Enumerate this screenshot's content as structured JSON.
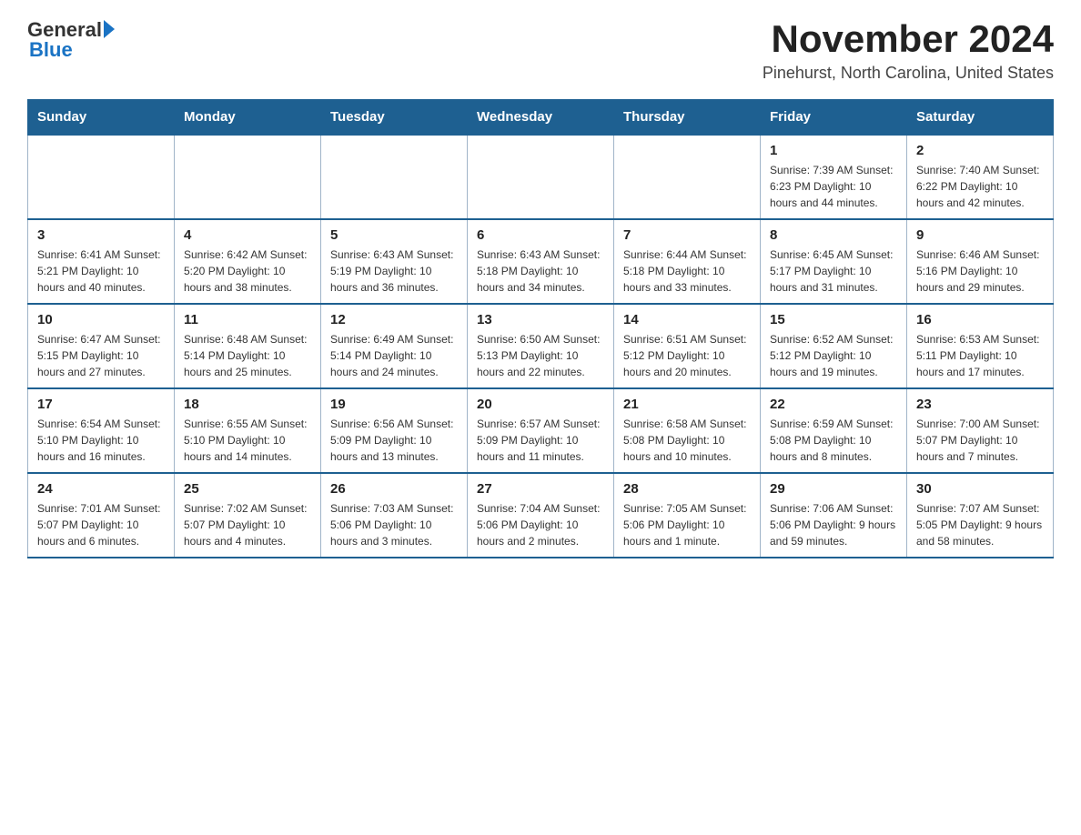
{
  "header": {
    "logo_general": "General",
    "logo_blue": "Blue",
    "title": "November 2024",
    "subtitle": "Pinehurst, North Carolina, United States"
  },
  "days_of_week": [
    "Sunday",
    "Monday",
    "Tuesday",
    "Wednesday",
    "Thursday",
    "Friday",
    "Saturday"
  ],
  "weeks": [
    {
      "days": [
        {
          "number": "",
          "info": ""
        },
        {
          "number": "",
          "info": ""
        },
        {
          "number": "",
          "info": ""
        },
        {
          "number": "",
          "info": ""
        },
        {
          "number": "",
          "info": ""
        },
        {
          "number": "1",
          "info": "Sunrise: 7:39 AM\nSunset: 6:23 PM\nDaylight: 10 hours and 44 minutes."
        },
        {
          "number": "2",
          "info": "Sunrise: 7:40 AM\nSunset: 6:22 PM\nDaylight: 10 hours and 42 minutes."
        }
      ]
    },
    {
      "days": [
        {
          "number": "3",
          "info": "Sunrise: 6:41 AM\nSunset: 5:21 PM\nDaylight: 10 hours and 40 minutes."
        },
        {
          "number": "4",
          "info": "Sunrise: 6:42 AM\nSunset: 5:20 PM\nDaylight: 10 hours and 38 minutes."
        },
        {
          "number": "5",
          "info": "Sunrise: 6:43 AM\nSunset: 5:19 PM\nDaylight: 10 hours and 36 minutes."
        },
        {
          "number": "6",
          "info": "Sunrise: 6:43 AM\nSunset: 5:18 PM\nDaylight: 10 hours and 34 minutes."
        },
        {
          "number": "7",
          "info": "Sunrise: 6:44 AM\nSunset: 5:18 PM\nDaylight: 10 hours and 33 minutes."
        },
        {
          "number": "8",
          "info": "Sunrise: 6:45 AM\nSunset: 5:17 PM\nDaylight: 10 hours and 31 minutes."
        },
        {
          "number": "9",
          "info": "Sunrise: 6:46 AM\nSunset: 5:16 PM\nDaylight: 10 hours and 29 minutes."
        }
      ]
    },
    {
      "days": [
        {
          "number": "10",
          "info": "Sunrise: 6:47 AM\nSunset: 5:15 PM\nDaylight: 10 hours and 27 minutes."
        },
        {
          "number": "11",
          "info": "Sunrise: 6:48 AM\nSunset: 5:14 PM\nDaylight: 10 hours and 25 minutes."
        },
        {
          "number": "12",
          "info": "Sunrise: 6:49 AM\nSunset: 5:14 PM\nDaylight: 10 hours and 24 minutes."
        },
        {
          "number": "13",
          "info": "Sunrise: 6:50 AM\nSunset: 5:13 PM\nDaylight: 10 hours and 22 minutes."
        },
        {
          "number": "14",
          "info": "Sunrise: 6:51 AM\nSunset: 5:12 PM\nDaylight: 10 hours and 20 minutes."
        },
        {
          "number": "15",
          "info": "Sunrise: 6:52 AM\nSunset: 5:12 PM\nDaylight: 10 hours and 19 minutes."
        },
        {
          "number": "16",
          "info": "Sunrise: 6:53 AM\nSunset: 5:11 PM\nDaylight: 10 hours and 17 minutes."
        }
      ]
    },
    {
      "days": [
        {
          "number": "17",
          "info": "Sunrise: 6:54 AM\nSunset: 5:10 PM\nDaylight: 10 hours and 16 minutes."
        },
        {
          "number": "18",
          "info": "Sunrise: 6:55 AM\nSunset: 5:10 PM\nDaylight: 10 hours and 14 minutes."
        },
        {
          "number": "19",
          "info": "Sunrise: 6:56 AM\nSunset: 5:09 PM\nDaylight: 10 hours and 13 minutes."
        },
        {
          "number": "20",
          "info": "Sunrise: 6:57 AM\nSunset: 5:09 PM\nDaylight: 10 hours and 11 minutes."
        },
        {
          "number": "21",
          "info": "Sunrise: 6:58 AM\nSunset: 5:08 PM\nDaylight: 10 hours and 10 minutes."
        },
        {
          "number": "22",
          "info": "Sunrise: 6:59 AM\nSunset: 5:08 PM\nDaylight: 10 hours and 8 minutes."
        },
        {
          "number": "23",
          "info": "Sunrise: 7:00 AM\nSunset: 5:07 PM\nDaylight: 10 hours and 7 minutes."
        }
      ]
    },
    {
      "days": [
        {
          "number": "24",
          "info": "Sunrise: 7:01 AM\nSunset: 5:07 PM\nDaylight: 10 hours and 6 minutes."
        },
        {
          "number": "25",
          "info": "Sunrise: 7:02 AM\nSunset: 5:07 PM\nDaylight: 10 hours and 4 minutes."
        },
        {
          "number": "26",
          "info": "Sunrise: 7:03 AM\nSunset: 5:06 PM\nDaylight: 10 hours and 3 minutes."
        },
        {
          "number": "27",
          "info": "Sunrise: 7:04 AM\nSunset: 5:06 PM\nDaylight: 10 hours and 2 minutes."
        },
        {
          "number": "28",
          "info": "Sunrise: 7:05 AM\nSunset: 5:06 PM\nDaylight: 10 hours and 1 minute."
        },
        {
          "number": "29",
          "info": "Sunrise: 7:06 AM\nSunset: 5:06 PM\nDaylight: 9 hours and 59 minutes."
        },
        {
          "number": "30",
          "info": "Sunrise: 7:07 AM\nSunset: 5:05 PM\nDaylight: 9 hours and 58 minutes."
        }
      ]
    }
  ]
}
